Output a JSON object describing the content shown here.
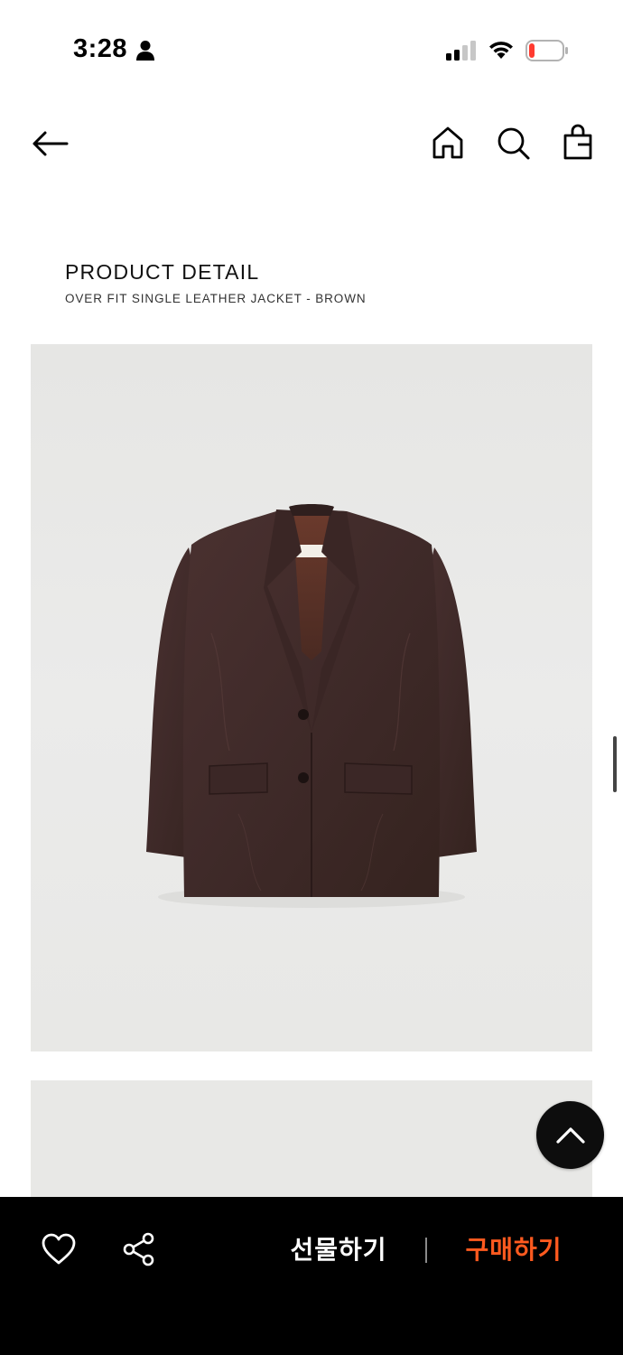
{
  "status_bar": {
    "time": "3:28",
    "icons": [
      "person-icon",
      "signal-icon",
      "wifi-icon",
      "battery-icon"
    ],
    "battery_color": "#ff3b30"
  },
  "nav": {
    "icons": [
      "back-arrow-icon",
      "home-icon",
      "search-icon",
      "shopping-bag-icon"
    ]
  },
  "product": {
    "heading": "PRODUCT DETAIL",
    "name": "OVER FIT SINGLE LEATHER JACKET - BROWN",
    "image_label": "brown leather jacket"
  },
  "bottom_bar": {
    "gift_label": "선물하기",
    "buy_label": "구매하기",
    "buy_color": "#ff5a1f",
    "icons": [
      "heart-icon",
      "share-icon"
    ]
  },
  "floating": {
    "icon": "chevron-up-icon"
  }
}
